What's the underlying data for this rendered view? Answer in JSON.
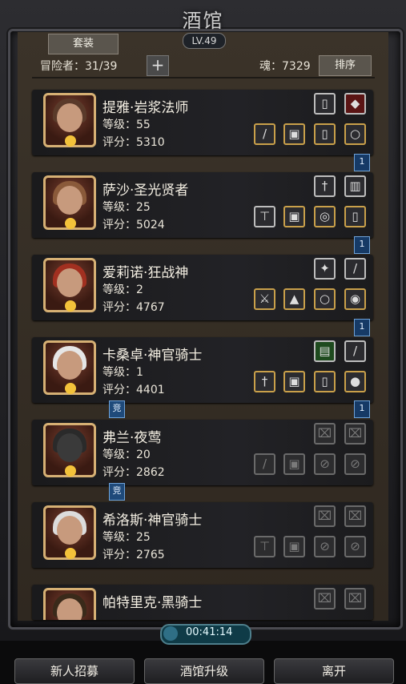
{
  "header": {
    "title": "酒馆",
    "level": "LV.49",
    "suit_button": "套装",
    "adventurers": "冒险者：31/39",
    "soul": "魂：7329",
    "sort_button": "排序"
  },
  "heroes": [
    {
      "name": "提雅·岩浆法师",
      "level": "等级：55",
      "score": "评分：5310"
    },
    {
      "name": "萨沙·圣光贤者",
      "level": "等级：25",
      "score": "评分：5024"
    },
    {
      "name": "爱莉诺·狂战神",
      "level": "等级：2",
      "score": "评分：4767"
    },
    {
      "name": "卡桑卓·神官骑士",
      "level": "等级：1",
      "score": "评分：4401"
    },
    {
      "name": "弗兰·夜莺",
      "level": "等级：20",
      "score": "评分：2862"
    },
    {
      "name": "希洛斯·神官骑士",
      "level": "等级：25",
      "score": "评分：2765"
    },
    {
      "name": "帕特里克·黑骑士",
      "level": "",
      "score": ""
    }
  ],
  "badges": {
    "arena": "竞",
    "rank": "1"
  },
  "timer": {
    "time": "00:41:14"
  },
  "footer": {
    "recruit": "新人招募",
    "upgrade": "酒馆升级",
    "leave": "离开"
  }
}
